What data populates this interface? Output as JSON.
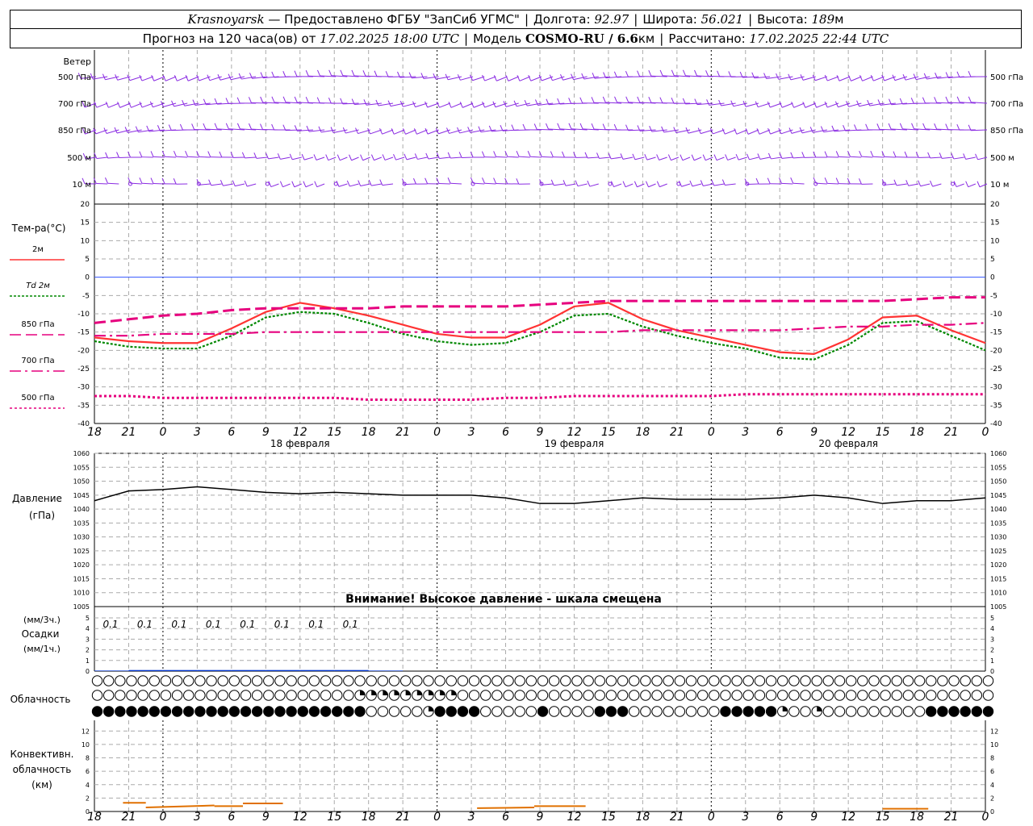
{
  "header": {
    "city": "Krasnoyarsk",
    "provider": "— Предоставлено ФГБУ \"ЗапСиб УГМС\"",
    "lon_label": "Долгота:",
    "lon": "92.97",
    "lat_label": "Широта:",
    "lat": "56.021",
    "alt_label": "Высота:",
    "alt": "189",
    "alt_unit": "м",
    "forecast_label": "Прогноз на 120 часа(ов) от",
    "forecast_from": "17.02.2025 18:00 UTC",
    "model_label": "Модель",
    "model": "COSMO-RU / 6.6",
    "model_unit": "км",
    "calc_label": "Рассчитано:",
    "calc_time": "17.02.2025 22:44 UTC"
  },
  "wind_panel": {
    "title": "Ветер",
    "levels": [
      "500 гПа",
      "700 гПа",
      "850 гПа",
      "500 м",
      "10 м"
    ]
  },
  "temp_panel": {
    "title": "Тем-ра(°С)",
    "legend": [
      {
        "label": "2м",
        "color": "#ff3333"
      },
      {
        "label": "Td  2м",
        "color": "#008800"
      },
      {
        "label": "850 гПа",
        "color": "#e6007e"
      },
      {
        "label": "700 гПа",
        "color": "#e6007e"
      },
      {
        "label": "500 гПа",
        "color": "#e6007e"
      }
    ]
  },
  "pressure_panel": {
    "title": "Давление",
    "unit": "(гПа)",
    "warning": "Внимание! Высокое давление - шкала смещена"
  },
  "precip_panel": {
    "title": "Осадки",
    "unit_top": "(мм/3ч.)",
    "unit_bottom": "(мм/1ч.)",
    "labels": [
      "0.1",
      "0.1",
      "0.1",
      "0.1",
      "0.1",
      "0.1",
      "0.1",
      "0.1"
    ]
  },
  "cloud_panel": {
    "title": "Облачность"
  },
  "conv_panel": {
    "title_lines": [
      "Конвективн.",
      "облачность",
      "(км)"
    ]
  },
  "time_axis": {
    "hour_ticks": [
      "18",
      "21",
      "0",
      "3",
      "6",
      "9",
      "12",
      "15",
      "18",
      "21",
      "0",
      "3",
      "6",
      "9",
      "12",
      "15",
      "18",
      "21",
      "0",
      "3",
      "6",
      "9",
      "12",
      "15",
      "18",
      "21",
      "0"
    ],
    "dates": [
      "18 февраля",
      "19 февраля",
      "20 февраля"
    ]
  },
  "colors": {
    "wind": "#8a2be2",
    "t2m": "#ff3333",
    "td2m": "#008800",
    "upper": "#e6007e",
    "zero_line": "#3355ff",
    "pressure": "#000000",
    "precip": "#0033cc",
    "conv": "#e07000"
  },
  "chart_data": [
    {
      "type": "line",
      "title": "Тем-ра(°С)",
      "x": [
        0,
        3,
        6,
        9,
        12,
        15,
        18,
        21,
        24,
        27,
        30,
        33,
        36,
        39,
        42,
        45,
        48,
        51,
        54,
        57,
        60,
        63,
        66,
        69,
        72,
        75,
        78
      ],
      "ylim": [
        -40,
        20
      ],
      "yticks": [
        20,
        15,
        10,
        5,
        0,
        -5,
        -10,
        -15,
        -20,
        -25,
        -30,
        -35,
        -40
      ],
      "series": [
        {
          "name": "2м",
          "values": [
            -16.5,
            -17.5,
            -18,
            -18,
            -14,
            -9.5,
            -7,
            -8.5,
            -10.5,
            -13,
            -15.5,
            -16.5,
            -16.5,
            -13,
            -8,
            -7,
            -11.5,
            -14.5,
            -16.5,
            -18.5,
            -20.5,
            -21,
            -17,
            -11,
            -10.5,
            -14.5,
            -18
          ]
        },
        {
          "name": "Td  2м",
          "values": [
            -17.5,
            -19,
            -19.5,
            -19.5,
            -16,
            -11,
            -9.5,
            -10,
            -12.5,
            -15.5,
            -17.5,
            -18.5,
            -18,
            -15,
            -10.5,
            -10,
            -13.5,
            -16,
            -18,
            -19.5,
            -22,
            -22.5,
            -18.5,
            -12.5,
            -12,
            -16,
            -20
          ]
        },
        {
          "name": "850 гПа",
          "values": [
            -12.5,
            -11.5,
            -10.5,
            -10,
            -9,
            -8.5,
            -8.5,
            -8.5,
            -8.5,
            -8,
            -8,
            -8,
            -8,
            -7.5,
            -7,
            -6.5,
            -6.5,
            -6.5,
            -6.5,
            -6.5,
            -6.5,
            -6.5,
            -6.5,
            -6.5,
            -6,
            -5.5,
            -5.5
          ]
        },
        {
          "name": "700 гПа",
          "values": [
            -16,
            -16,
            -15.5,
            -15.5,
            -15.5,
            -15,
            -15,
            -15,
            -15,
            -15,
            -15,
            -15,
            -15,
            -15,
            -15,
            -15,
            -14.5,
            -14.5,
            -14.5,
            -14.5,
            -14.5,
            -14,
            -13.5,
            -13.5,
            -13,
            -13,
            -12.5
          ]
        },
        {
          "name": "500 гПа",
          "values": [
            -32.5,
            -32.5,
            -33,
            -33,
            -33,
            -33,
            -33,
            -33,
            -33.5,
            -33.5,
            -33.5,
            -33.5,
            -33,
            -33,
            -32.5,
            -32.5,
            -32.5,
            -32.5,
            -32.5,
            -32,
            -32,
            -32,
            -32,
            -32,
            -32,
            -32,
            -32
          ]
        }
      ]
    },
    {
      "type": "line",
      "title": "Давление",
      "x": [
        0,
        3,
        6,
        9,
        12,
        15,
        18,
        21,
        24,
        27,
        30,
        33,
        36,
        39,
        42,
        45,
        48,
        51,
        54,
        57,
        60,
        63,
        66,
        69,
        72,
        75,
        78
      ],
      "ylim": [
        1005,
        1060
      ],
      "yticks": [
        1060,
        1055,
        1050,
        1045,
        1040,
        1035,
        1030,
        1025,
        1020,
        1015,
        1010,
        1005
      ],
      "series": [
        {
          "name": "",
          "values": [
            1043,
            1046.5,
            1047,
            1048,
            1047,
            1046,
            1045.5,
            1046,
            1045.5,
            1045,
            1045,
            1045,
            1044,
            1042,
            1042,
            1043,
            1044,
            1043.5,
            1043.5,
            1043.5,
            1044,
            1045,
            1044,
            1042,
            1043,
            1043,
            1044
          ]
        }
      ]
    },
    {
      "type": "bar",
      "title": "Осадки",
      "x": [
        0,
        3,
        6,
        9,
        12,
        15,
        18,
        21,
        24,
        27,
        30
      ],
      "ylim": [
        0,
        5
      ],
      "yticks": [
        5,
        4,
        3,
        2,
        1,
        0
      ],
      "series": [
        {
          "name": "",
          "values": [
            0.05,
            0.1,
            0.1,
            0.1,
            0.1,
            0.1,
            0.1,
            0.1,
            0.05,
            0,
            0
          ]
        }
      ]
    },
    {
      "type": "line",
      "title": "Конвективн. облачность (км)",
      "ylim": [
        0,
        13
      ],
      "yticks": [
        12,
        10,
        8,
        6,
        4,
        2,
        0
      ],
      "segments": [
        {
          "x": [
            2.5,
            4.5
          ],
          "values": [
            1.3,
            1.3
          ]
        },
        {
          "x": [
            4.5,
            10.5
          ],
          "values": [
            0.6,
            0.9
          ]
        },
        {
          "x": [
            10.5,
            13
          ],
          "values": [
            0.8,
            0.8
          ]
        },
        {
          "x": [
            13,
            16.5
          ],
          "values": [
            1.2,
            1.2
          ]
        },
        {
          "x": [
            33.5,
            38.5
          ],
          "values": [
            0.5,
            0.6
          ]
        },
        {
          "x": [
            38.5,
            43
          ],
          "values": [
            0.8,
            0.8
          ]
        },
        {
          "x": [
            69,
            73
          ],
          "values": [
            0.4,
            0.4
          ]
        }
      ]
    }
  ]
}
